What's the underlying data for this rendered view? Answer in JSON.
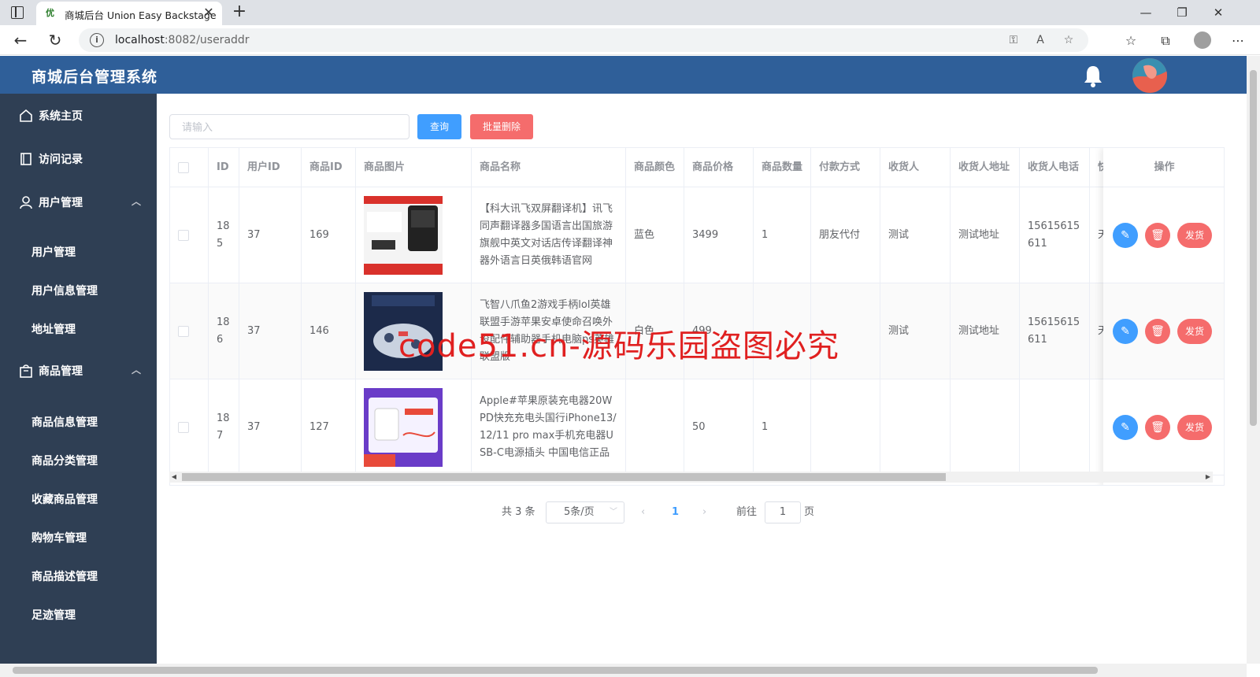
{
  "browser": {
    "tab_title": "商城后台 Union Easy Backstage",
    "url_host": "localhost",
    "url_rest": ":8082/useraddr"
  },
  "app": {
    "title": "商城后台管理系统"
  },
  "sidebar": {
    "items": [
      {
        "label": "系统主页",
        "icon": "home-icon"
      },
      {
        "label": "访问记录",
        "icon": "notebook-icon"
      },
      {
        "label": "用户管理",
        "icon": "user-icon"
      },
      {
        "label": "商品管理",
        "icon": "bag-icon"
      }
    ],
    "user_sub": [
      "用户管理",
      "用户信息管理",
      "地址管理"
    ],
    "goods_sub": [
      "商品信息管理",
      "商品分类管理",
      "收藏商品管理",
      "购物车管理",
      "商品描述管理",
      "足迹管理"
    ]
  },
  "toolbar": {
    "search_placeholder": "请输入",
    "query_label": "查询",
    "batch_delete_label": "批量删除"
  },
  "table": {
    "headers": [
      "ID",
      "用户ID",
      "商品ID",
      "商品图片",
      "商品名称",
      "商品颜色",
      "商品价格",
      "商品数量",
      "付款方式",
      "收货人",
      "收货人地址",
      "收货人电话",
      "快"
    ],
    "ops_header": "操作",
    "rows": [
      {
        "id": "185",
        "user_id": "37",
        "goods_id": "169",
        "name": "【科大讯飞双屏翻译机】讯飞同声翻译器多国语言出国旅游旗舰中英文对话店传译翻译神器外语言日英俄韩语官网",
        "color": "蓝色",
        "price": "3499",
        "qty": "1",
        "pay": "朋友代付",
        "receiver": "测试",
        "address": "测试地址",
        "phone": "15615615611",
        "extra": "天"
      },
      {
        "id": "186",
        "user_id": "37",
        "goods_id": "146",
        "name": "飞智八爪鱼2游戏手柄lol英雄联盟手游苹果安卓使命召唤外设配件辅助器手机电脑ps英雄联盟版",
        "color": "白色",
        "price": "499",
        "qty": "",
        "pay": "",
        "receiver": "测试",
        "address": "测试地址",
        "phone": "15615615611",
        "extra": "天"
      },
      {
        "id": "187",
        "user_id": "37",
        "goods_id": "127",
        "name": "Apple#苹果原装充电器20W PD快充充电头国行iPhone13/12/11 pro max手机充电器USB-C电源插头 中国电信正品",
        "color": "",
        "price": "50",
        "qty": "1",
        "pay": "",
        "receiver": "",
        "address": "",
        "phone": "",
        "extra": ""
      }
    ],
    "ship_label": "发货"
  },
  "pagination": {
    "total": "共 3 条",
    "page_size": "5条/页",
    "current": "1",
    "goto_label": "前往",
    "goto_value": "1",
    "page_label": "页"
  },
  "watermark": "code51.cn-源码乐园盗图必究",
  "colors": {
    "header": "#2f5f99",
    "sidebar": "#2f3f54",
    "primary": "#409eff",
    "danger": "#f56c6c"
  }
}
